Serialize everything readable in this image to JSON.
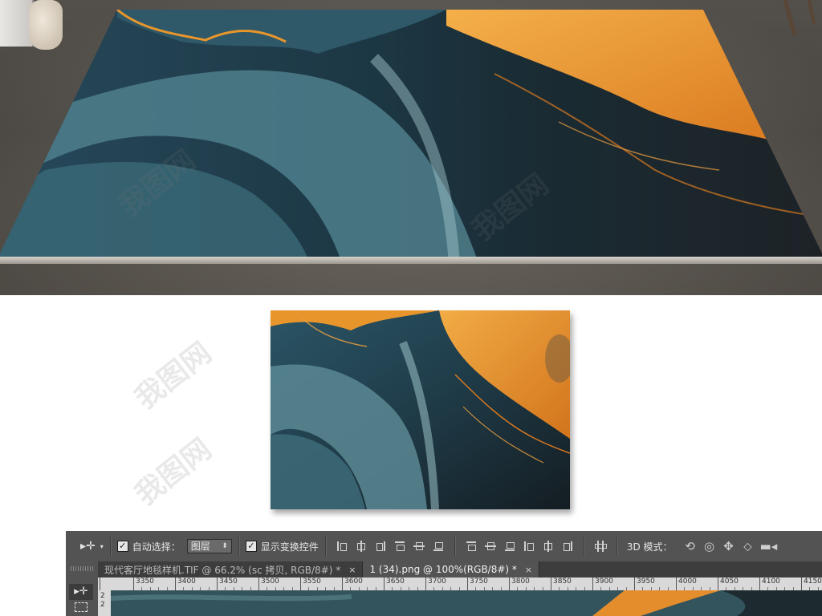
{
  "watermark": {
    "text": "我图网"
  },
  "toolbar_options": {
    "auto_select_checked": true,
    "auto_select_label": "自动选择：",
    "auto_select_target": "图层",
    "show_transform_checked": true,
    "show_transform_label": "显示变换控件",
    "mode_3d_label": "3D 模式："
  },
  "document_tabs": [
    {
      "label": "现代客厅地毯样机.TIF @ 66.2% (sc 拷贝, RGB/8#) *",
      "close": "×",
      "active": false
    },
    {
      "label": "1 (34).png @ 100%(RGB/8#) *",
      "close": "×",
      "active": true
    }
  ],
  "ruler": {
    "ticks": [
      "3350",
      "3400",
      "3450",
      "3500",
      "3550",
      "3600",
      "3650",
      "3700",
      "3750",
      "3800",
      "3850",
      "3900",
      "3950",
      "4000",
      "4050",
      "4100",
      "4150"
    ],
    "left_ticks": [
      "2",
      "2"
    ]
  },
  "colors": {
    "teal_dark": "#1f3d4a",
    "teal_mid": "#3e6a78",
    "teal_light": "#7aa3ad",
    "orange": "#e8962c",
    "orange_light": "#f4b04a",
    "ps_panel": "#535353"
  }
}
